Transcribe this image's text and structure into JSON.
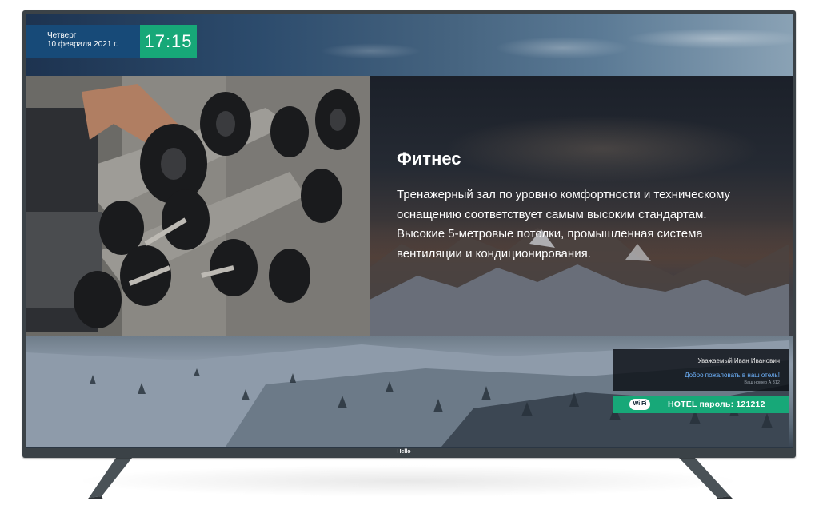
{
  "header": {
    "weekday": "Четверг",
    "date": "10 февраля 2021 г.",
    "time": "17:15"
  },
  "content": {
    "title": "Фитнес",
    "body": "Тренажерный зал по уровню комфортности и техническому оснащению соответствует самым высоким стандартам. Высокие 5-метровые потолки, промышленная система вентиляции и кондиционирования."
  },
  "guest": {
    "name": "Уважаемый Иван Иванович",
    "welcome": "Добро пожаловать в наш отель!",
    "room": "Ваш номер А 312"
  },
  "wifi": {
    "icon_label": "Wi Fi",
    "password_text": "HOTEL пароль: 121212"
  },
  "brand": {
    "logo": "Hello"
  },
  "colors": {
    "date_bg": "#174a78",
    "accent_green": "#17a878",
    "welcome_blue": "#6fb4ff"
  },
  "icons": [
    "wifi-icon",
    "dumbbell-rack-photo"
  ]
}
